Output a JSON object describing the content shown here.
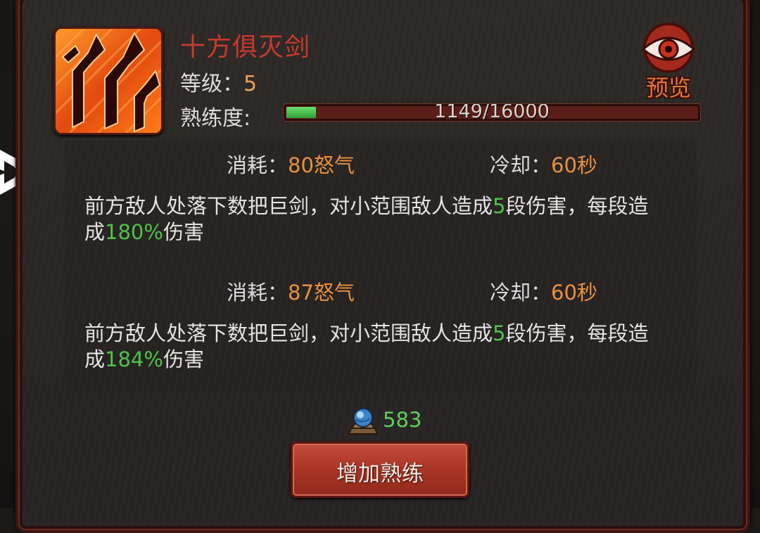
{
  "skill": {
    "name": "十方俱灭剑",
    "level_label": "等级：",
    "level_value": "5",
    "proficiency_label": "熟练度:",
    "proficiency_text": "1149/16000",
    "proficiency_current": 1149,
    "proficiency_max": 16000
  },
  "preview": {
    "label": "预览",
    "icon": "eye-icon"
  },
  "tiers": [
    {
      "cost_label": "消耗：",
      "cost_value": "80怒气",
      "cooldown_label": "冷却：",
      "cooldown_value": "60秒",
      "desc_part1": "前方敌人处落下数把巨剑，对小范围敌人造成",
      "desc_hits": "5",
      "desc_part2": "段伤害，每段造",
      "desc_part3": "成",
      "desc_percent": "180%",
      "desc_part4": "伤害"
    },
    {
      "cost_label": "消耗：",
      "cost_value": "87怒气",
      "cooldown_label": "冷却：",
      "cooldown_value": "60秒",
      "desc_part1": "前方敌人处落下数把巨剑，对小范围敌人造成",
      "desc_hits": "5",
      "desc_part2": "段伤害，每段造",
      "desc_part3": "成",
      "desc_percent": "184%",
      "desc_part4": "伤害"
    }
  ],
  "currency": {
    "icon": "crystal-orb-icon",
    "amount": "583"
  },
  "action": {
    "label": "增加熟练"
  },
  "colors": {
    "skill_name": "#c83a2c",
    "value_orange": "#e8913e",
    "highlight_green": "#4fc24a",
    "button_red": "#a83424"
  }
}
